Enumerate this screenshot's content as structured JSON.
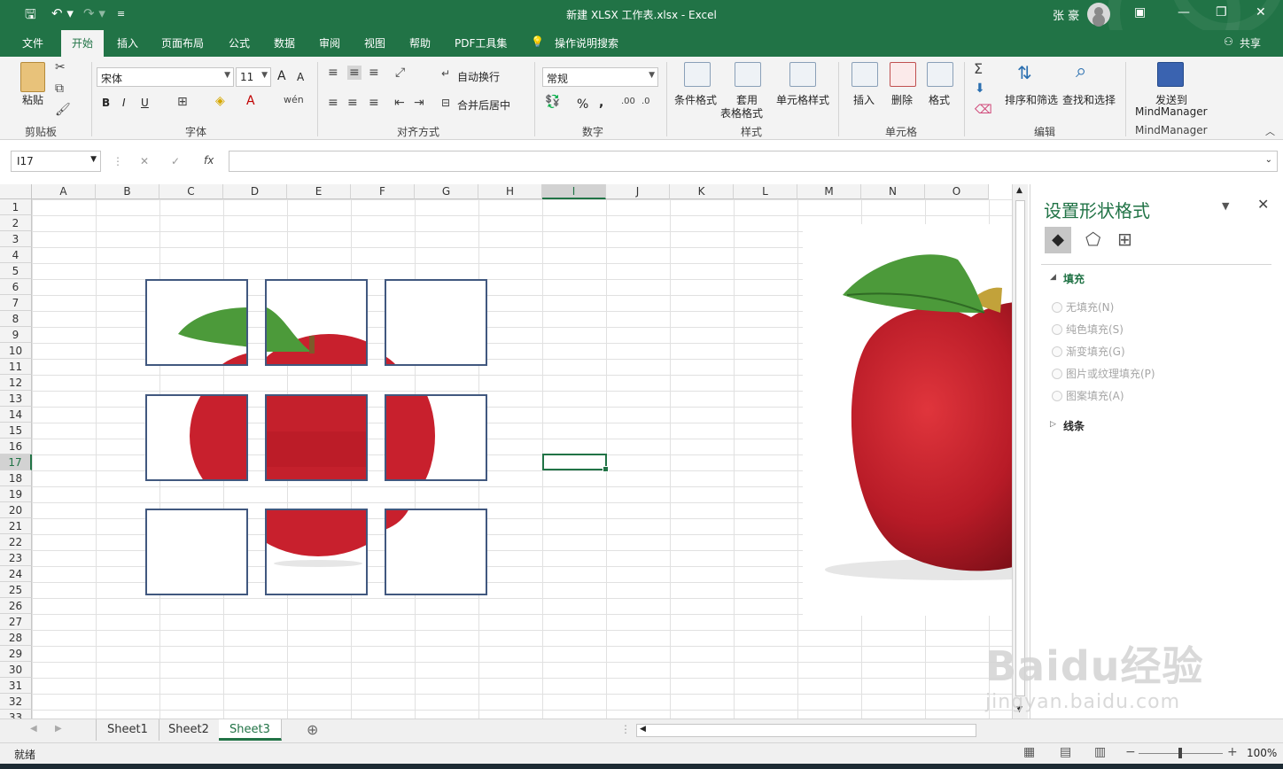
{
  "window": {
    "title": "新建 XLSX 工作表.xlsx  -  Excel",
    "user": "张 豪",
    "share": "共享"
  },
  "ribbon_tabs": [
    {
      "label": "文件"
    },
    {
      "label": "开始"
    },
    {
      "label": "插入"
    },
    {
      "label": "页面布局"
    },
    {
      "label": "公式"
    },
    {
      "label": "数据"
    },
    {
      "label": "审阅"
    },
    {
      "label": "视图"
    },
    {
      "label": "帮助"
    },
    {
      "label": "PDF工具集"
    }
  ],
  "tell_me": "操作说明搜索",
  "ribbon": {
    "clipboard": {
      "paste": "粘贴",
      "label": "剪贴板"
    },
    "font": {
      "name": "宋体",
      "size": "11",
      "grow": "A",
      "shrink": "A",
      "bold": "B",
      "italic": "I",
      "underline": "U",
      "label": "字体"
    },
    "alignment": {
      "wrap": "自动换行",
      "merge": "合并后居中",
      "label": "对齐方式"
    },
    "number": {
      "format": "常规",
      "percent": "%",
      "comma": ",",
      "label": "数字"
    },
    "styles": {
      "conditional": "条件格式",
      "table_line1": "套用",
      "table_line2": "表格格式",
      "cell_styles": "单元格样式",
      "label": "样式"
    },
    "cells": {
      "insert": "插入",
      "delete": "删除",
      "format": "格式",
      "label": "单元格"
    },
    "editing": {
      "sort": "排序和筛选",
      "find": "查找和选择",
      "label": "编辑"
    },
    "mindmanager": {
      "send_line1": "发送到",
      "send_line2": "MindManager",
      "label": "MindManager"
    }
  },
  "formula_bar": {
    "name_box": "I17",
    "fx": "fx",
    "cancel": "✕",
    "enter": "✓",
    "value": ""
  },
  "columns": [
    "A",
    "B",
    "C",
    "D",
    "E",
    "F",
    "G",
    "H",
    "I",
    "J",
    "K",
    "L",
    "M",
    "N",
    "O"
  ],
  "selected_column": "I",
  "rows": [
    "1",
    "2",
    "3",
    "4",
    "5",
    "6",
    "7",
    "8",
    "9",
    "10",
    "11",
    "12",
    "13",
    "14",
    "15",
    "16",
    "17",
    "18",
    "19",
    "20",
    "21",
    "22",
    "23",
    "24",
    "25",
    "26",
    "27",
    "28",
    "29",
    "30",
    "31",
    "32",
    "33"
  ],
  "selected_row": "17",
  "task_pane": {
    "title": "设置形状格式",
    "fill_section": "填充",
    "fill_options": [
      {
        "label": "无填充(N)"
      },
      {
        "label": "纯色填充(S)"
      },
      {
        "label": "渐变填充(G)"
      },
      {
        "label": "图片或纹理填充(P)"
      },
      {
        "label": "图案填充(A)"
      }
    ],
    "line_section": "线条"
  },
  "sheets": [
    {
      "label": "Sheet1"
    },
    {
      "label": "Sheet2"
    },
    {
      "label": "Sheet3"
    }
  ],
  "active_sheet": "Sheet3",
  "status": {
    "ready": "就绪",
    "zoom": "100%"
  },
  "watermark": {
    "brand": "Baidu经验",
    "url": "jingyan.baidu.com"
  },
  "colors": {
    "excel_green": "#217346",
    "tile_border": "#41587f",
    "apple_red": "#c8202d",
    "leaf_green": "#4c9a3a"
  }
}
